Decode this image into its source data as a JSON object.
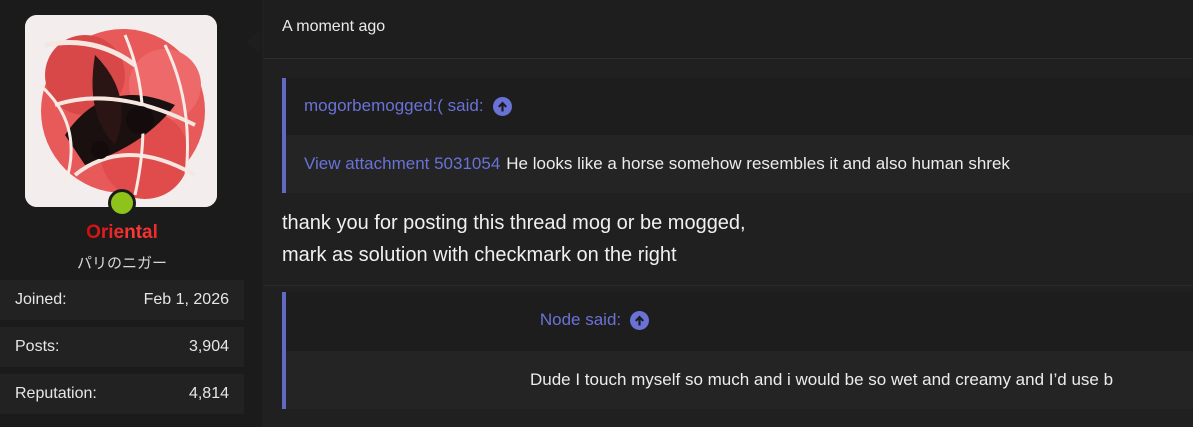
{
  "user": {
    "username": "Oriental",
    "title": "パリのニガー",
    "online": true,
    "stats": [
      {
        "label": "Joined:",
        "value": "Feb 1, 2026"
      },
      {
        "label": "Posts:",
        "value": "3,904"
      },
      {
        "label": "Reputation:",
        "value": "4,814"
      }
    ]
  },
  "post": {
    "timestamp": "A moment ago",
    "quote1": {
      "author": "mogorbemogged:( said:",
      "attachment_link": "View attachment 5031054",
      "text": "He looks like a horse somehow resembles it and also human shrek"
    },
    "message_lines": [
      "thank you for posting this thread mog or be mogged,",
      "mark as solution with checkmark on the right"
    ],
    "quote2": {
      "author": "Node said:",
      "text": "Dude I touch myself so much and i would be so wet and creamy and I’d use b"
    }
  },
  "colors": {
    "accent": "#6a72d6",
    "online": "#8fc21a",
    "username": "#cc1010"
  },
  "icons": {
    "quote_jump": "arrow-up-circle-icon"
  }
}
